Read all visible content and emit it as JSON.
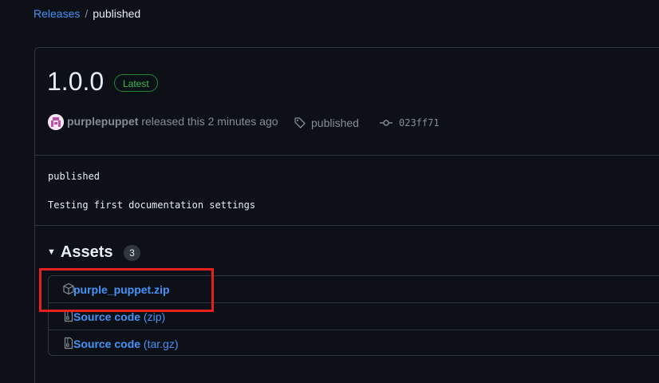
{
  "breadcrumb": {
    "parent": "Releases",
    "separator": "/",
    "current": "published"
  },
  "release": {
    "version": "1.0.0",
    "badge": "Latest",
    "author": "purplepuppet",
    "released_text": "released this 2 minutes ago",
    "tag_icon": "tag-icon",
    "tag": "published",
    "commit_icon": "git-commit-icon",
    "commit": "023ff71"
  },
  "body": {
    "line1": "published",
    "line2": "Testing first documentation settings"
  },
  "assets": {
    "title": "Assets",
    "count": "3",
    "items": [
      {
        "icon": "package-icon",
        "name": "purple_puppet.zip",
        "suffix": ""
      },
      {
        "icon": "file-zip-icon",
        "name": "Source code",
        "suffix": "(zip)"
      },
      {
        "icon": "file-zip-icon",
        "name": "Source code",
        "suffix": "(tar.gz)"
      }
    ]
  },
  "colors": {
    "background": "#0d1117",
    "link": "#4493f8",
    "border": "#30363d",
    "muted": "#848d97",
    "latest_green": "#3fb950",
    "highlight_red": "#e5201f"
  }
}
